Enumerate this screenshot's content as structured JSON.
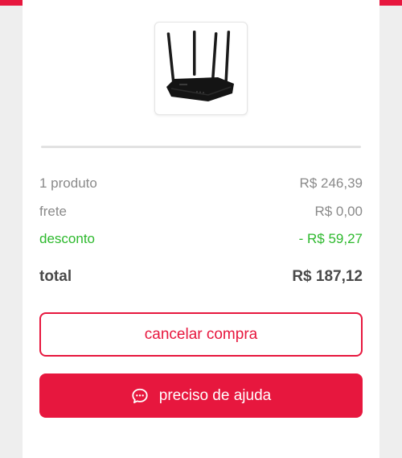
{
  "product": {
    "image_icon": "wifi-router"
  },
  "summary": {
    "products_label": "1 produto",
    "products_value": "R$ 246,39",
    "shipping_label": "frete",
    "shipping_value": "R$ 0,00",
    "discount_label": "desconto",
    "discount_value": "- R$ 59,27",
    "total_label": "total",
    "total_value": "R$ 187,12"
  },
  "actions": {
    "cancel_label": "cancelar compra",
    "help_label": "preciso de ajuda",
    "help_icon": "chat-bubble"
  },
  "colors": {
    "brand": "#e7173e",
    "discount": "#2db92d"
  }
}
